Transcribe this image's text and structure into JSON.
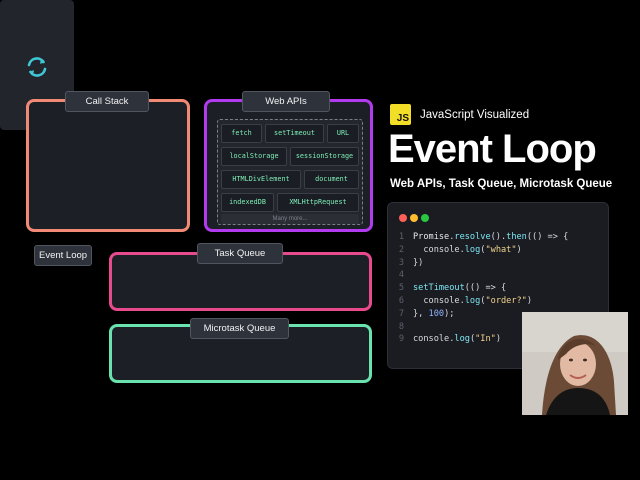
{
  "panels": {
    "call_stack": "Call Stack",
    "web_apis": "Web APIs",
    "event_loop": "Event Loop",
    "task_queue": "Task Queue",
    "microtask_queue": "Microtask Queue"
  },
  "web_api_items": [
    "fetch",
    "setTimeout",
    "URL",
    "localStorage",
    "sessionStorage",
    "HTMLDivElement",
    "document",
    "indexedDB",
    "XMLHttpRequest",
    "Many more..."
  ],
  "brand": {
    "logo": "JS",
    "label": "JavaScript Visualized"
  },
  "title": "Event Loop",
  "subtitle": "Web APIs, Task Queue, Microtask Queue",
  "code": {
    "line_numbers": [
      "1",
      "2",
      "3",
      "4",
      "5",
      "6",
      "7",
      "8",
      "9"
    ],
    "tokens": {
      "l1_a": "Promise",
      "l1_b": ".",
      "l1_c": "resolve",
      "l1_d": "().",
      "l1_e": "then",
      "l1_f": "(() => {",
      "l2_a": "  console.",
      "l2_b": "log",
      "l2_c": "(",
      "l2_d": "\"what\"",
      "l2_e": ")",
      "l3": "})",
      "l5_a": "setTimeout",
      "l5_b": "(() => {",
      "l6_a": "  console.",
      "l6_b": "log",
      "l6_c": "(",
      "l6_d": "\"order?\"",
      "l6_e": ")",
      "l7_a": "}, ",
      "l7_b": "100",
      "l7_c": ");",
      "l9_a": "console.",
      "l9_b": "log",
      "l9_c": "(",
      "l9_d": "\"In\"",
      "l9_e": ")"
    }
  },
  "colors": {
    "call_stack_border": "#f08a74",
    "web_apis_border": "#b33bef",
    "task_queue_border": "#e84a8e",
    "microtask_queue_border": "#69e2ad",
    "js_logo": "#f3de27",
    "loop_icon": "#3fc7d6",
    "window_dots": [
      "#ff5f57",
      "#febc2e",
      "#28c840"
    ]
  },
  "icons": {
    "event_loop": "refresh-cycle-icon"
  }
}
